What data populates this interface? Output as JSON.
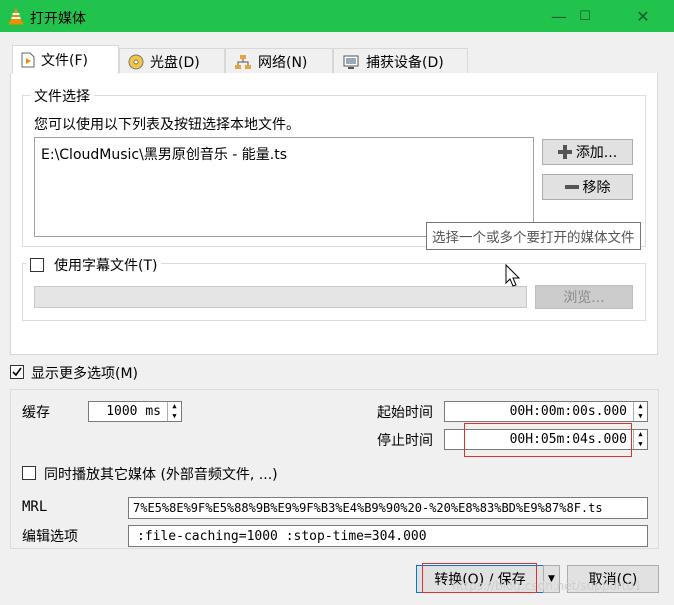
{
  "window": {
    "title": "打开媒体",
    "minimize": "—",
    "maximize": "☐",
    "close": "✕"
  },
  "tabs": [
    {
      "label": "文件(F)",
      "icon": "file-icon"
    },
    {
      "label": "光盘(D)",
      "icon": "disc-icon"
    },
    {
      "label": "网络(N)",
      "icon": "network-icon"
    },
    {
      "label": "捕获设备(D)",
      "icon": "capture-device-icon"
    }
  ],
  "file_section": {
    "legend": "文件选择",
    "description": "您可以使用以下列表及按钮选择本地文件。",
    "files": [
      "E:\\CloudMusic\\黑男原创音乐 - 能量.ts"
    ],
    "add_button": "添加...",
    "remove_button": "移除",
    "tooltip": "选择一个或多个要打开的媒体文件"
  },
  "subtitle": {
    "checkbox_label": "使用字幕文件(T)",
    "checked": false,
    "path_value": "",
    "browse_button": "浏览..."
  },
  "more_options": {
    "label": "显示更多选项(M)",
    "checked": true
  },
  "options": {
    "cache_label": "缓存",
    "cache_value": "1000 ms",
    "start_time_label": "起始时间",
    "start_time_value": "00H:00m:00s.000",
    "stop_time_label": "停止时间",
    "stop_time_value": "00H:05m:04s.000",
    "play_other_label": "同时播放其它媒体 (外部音频文件, ...)",
    "play_other_checked": false,
    "mrl_label": "MRL",
    "mrl_value": "7%E5%8E%9F%E5%88%9B%E9%9F%B3%E4%B9%90%20-%20%E8%83%BD%E9%87%8F.ts",
    "edit_options_label": "编辑选项",
    "edit_options_value": ":file-caching=1000 :stop-time=304.000"
  },
  "footer": {
    "convert_save_button": "转换(O) / 保存",
    "dropdown_arrow": "▼",
    "cancel_button": "取消(C)",
    "watermark": "https://blog.csdn.net/support01"
  },
  "colors": {
    "titlebar": "#21c34c",
    "highlight_box": "#e03030"
  }
}
